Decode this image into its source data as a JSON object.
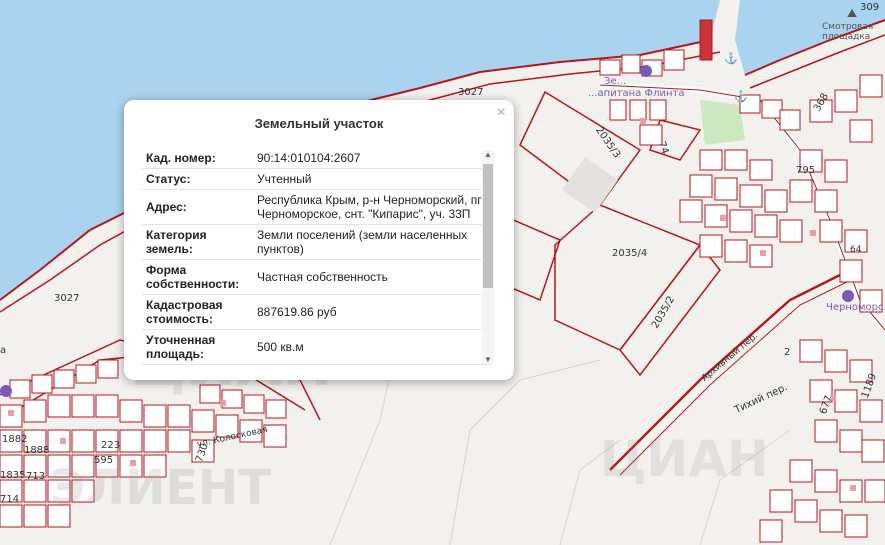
{
  "map": {
    "labels": {
      "plot_3027_top": "3027",
      "plot_3027_left": "3027",
      "plot_2035_3": "2035/3",
      "plot_2035_4": "2035/4",
      "plot_2035_2": "2035/2",
      "poi_smotrovaya": "Смотровая площадка",
      "poi_ze": "Зе...",
      "poi_kapitana": "...апитана Флинта",
      "poi_chernomor": "Черноморс...",
      "poi_a": "а",
      "street_tikhiy": "Тихий пер.",
      "street_arkhiv": "Архивный пер.",
      "street_kolos": "ул. Колосковая",
      "num_309": "309",
      "num_368": "368",
      "num_795": "795",
      "num_74": "74",
      "num_64": "64",
      "num_2": "2",
      "num_677": "677",
      "num_1189": "1189",
      "num_1882": "1882",
      "num_1888": "1888",
      "num_1835": "1835",
      "num_713": "713",
      "num_714": "714",
      "num_223": "223",
      "num_595": "595",
      "num_730": "730",
      "wm_left": "ЦИАН",
      "wm_right": "ЦИАН",
      "wm_bottom": "ЭЛИЕНТ"
    }
  },
  "popup": {
    "title": "Земельный участок",
    "close": "×",
    "rows": [
      {
        "key": "Кад. номер:",
        "value": "90:14:010104:2607"
      },
      {
        "key": "Статус:",
        "value": "Учтенный"
      },
      {
        "key": "Адрес:",
        "value": "Республика Крым, р-н Черноморский, пгт Черноморское, снт. \"Кипарис\", уч. 33П"
      },
      {
        "key": "Категория земель:",
        "value": "Земли поселений (земли населенных пунктов)"
      },
      {
        "key": "Форма собственности:",
        "value": "Частная собственность"
      },
      {
        "key": "Кадастровая стоимость:",
        "value": "887619.86 руб"
      },
      {
        "key": "Уточненная площадь:",
        "value": "500 кв.м"
      }
    ],
    "scroll_up": "▲",
    "scroll_down": "▼"
  },
  "colors": {
    "water": "#a9d3ee",
    "land": "#f3f1ee",
    "parcel": "#b3181e",
    "parcel_fill": "#e8a0a6",
    "green": "#cde7c0",
    "road": "#ffffff"
  },
  "icons": [
    "viewpoint-icon",
    "anchor-icon",
    "poi-icon",
    "close-icon",
    "scroll-arrow-icon"
  ]
}
